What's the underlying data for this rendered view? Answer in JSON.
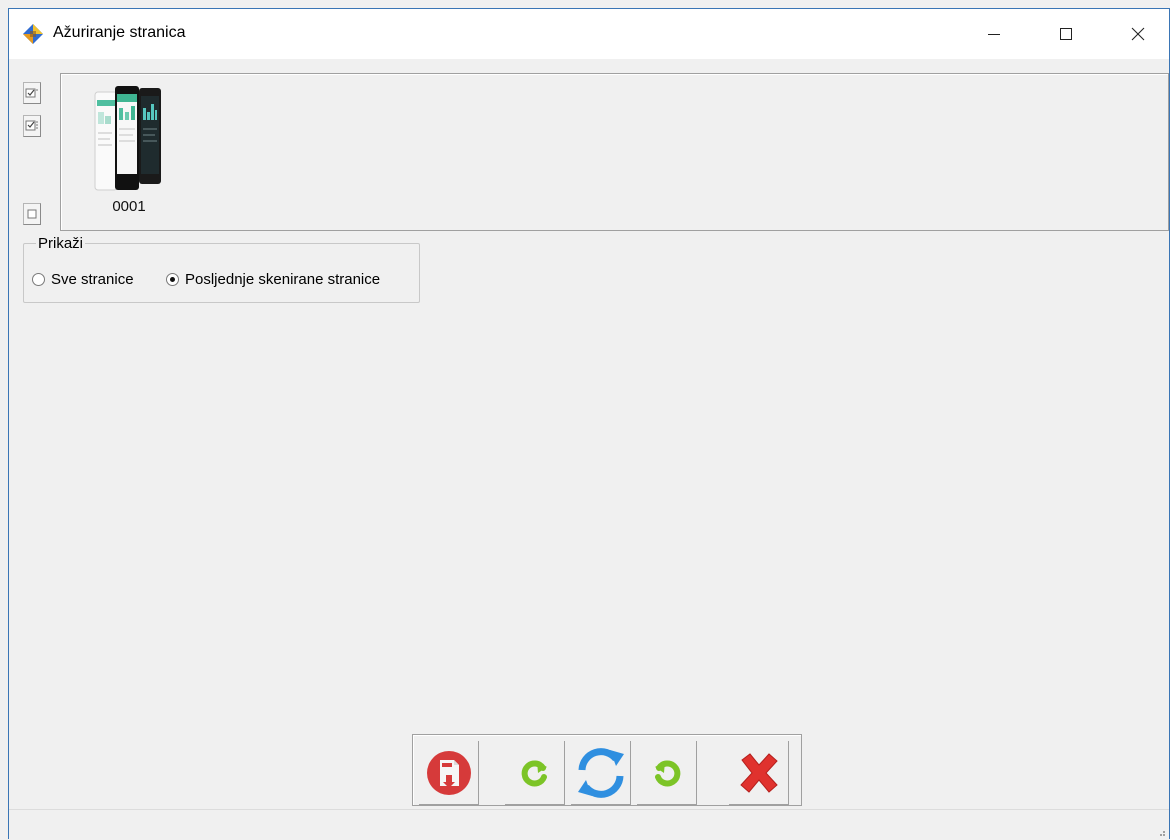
{
  "window": {
    "title": "Ažuriranje stranica",
    "controls": {
      "minimize": "minimize-icon",
      "maximize": "maximize-icon",
      "close": "close-icon"
    }
  },
  "sidebar_buttons": [
    {
      "icon": "check-all-icon"
    },
    {
      "icon": "check-list-icon"
    },
    {
      "icon": "uncheck-icon"
    }
  ],
  "thumbnails": [
    {
      "label": "0001"
    }
  ],
  "display_group": {
    "title": "Prikaži",
    "options": [
      {
        "label": "Sve stranice",
        "checked": false
      },
      {
        "label": "Posljednje skenirane stranice",
        "checked": true
      }
    ]
  },
  "toolbar": {
    "buttons": [
      {
        "icon": "pdf-export-icon"
      },
      {
        "icon": "rotate-left-icon"
      },
      {
        "icon": "refresh-icon"
      },
      {
        "icon": "rotate-right-icon"
      },
      {
        "icon": "delete-icon"
      }
    ]
  },
  "colors": {
    "border_accent": "#3a75b5",
    "pdf_red": "#d63a3a",
    "rotate_green": "#7cc427",
    "refresh_blue": "#2f8fe0",
    "delete_red": "#e0322e"
  }
}
